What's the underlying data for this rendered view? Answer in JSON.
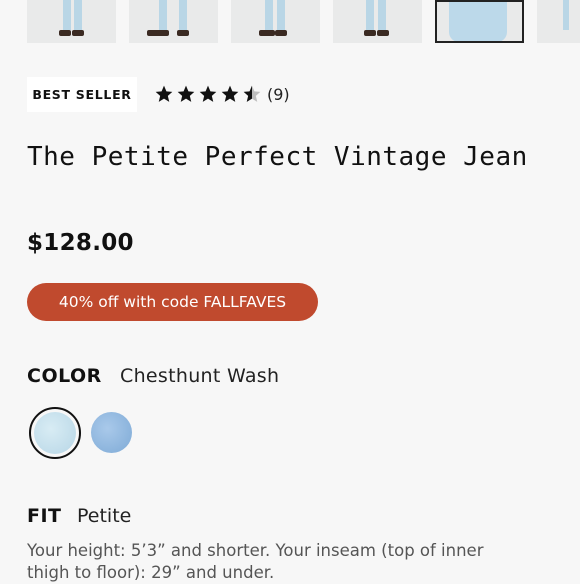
{
  "product": {
    "badge": "BEST SELLER",
    "rating": 4.5,
    "review_count": "(9)",
    "title": "The Petite Perfect Vintage Jean",
    "price": "$128.00",
    "promo": "40% off with code FALLFAVES"
  },
  "color": {
    "label": "COLOR",
    "value": "Chesthunt Wash",
    "swatches": [
      "#c6e1ee",
      "#93bbe2"
    ]
  },
  "fit": {
    "label": "FIT",
    "value": "Petite",
    "description": "Your height: 5’3” and shorter. Your inseam (top of inner thigh to floor): 29” and under."
  },
  "colors": {
    "promo_bg": "#c04a2e",
    "text": "#111111",
    "star": "#111111"
  }
}
